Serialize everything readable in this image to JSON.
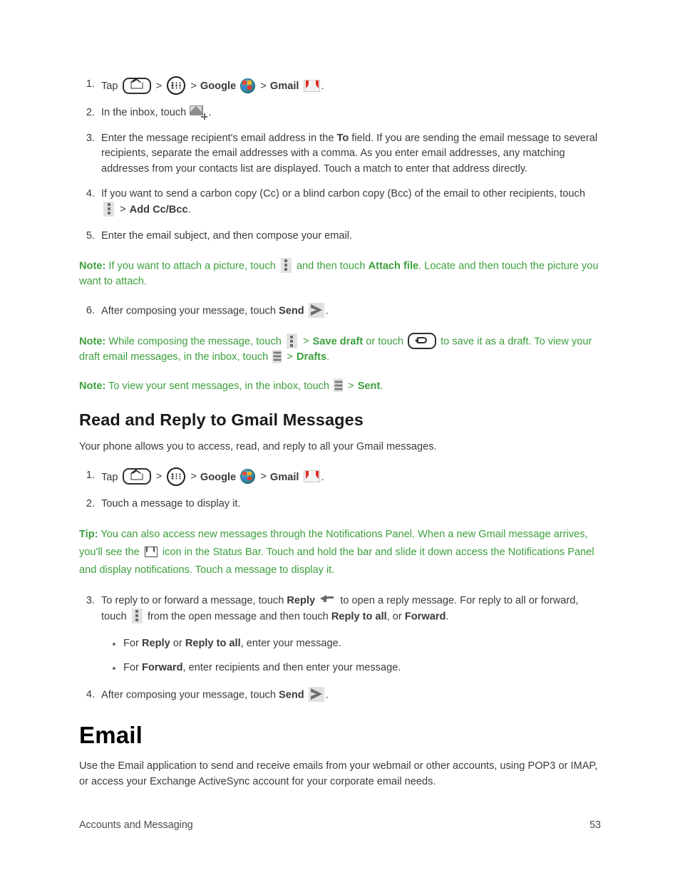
{
  "document": {
    "page_number": "53",
    "footer_section": "Accounts and Messaging",
    "note_color": "#3c9f3c",
    "body_color": "#3b3b3b"
  },
  "compose_steps": {
    "step1": {
      "number": "1.",
      "tap_label": "Tap",
      "sep": ">",
      "google_label": "Google",
      "gmail_label": "Gmail",
      "period": "."
    },
    "step2": {
      "number": "2.",
      "text_before": "In the inbox, touch",
      "period": "."
    },
    "step3": {
      "number": "3.",
      "text_a": "Enter the message recipient's email address in the",
      "bold_to": "To",
      "text_b": "field. If you are sending the email message to several recipients, separate the email addresses with a comma. As you enter email addresses, any matching addresses from your contacts list are displayed. Touch a match to enter that address directly."
    },
    "step4": {
      "number": "4.",
      "text_a": "If you want to send a carbon copy (Cc) or a blind carbon copy (Bcc) of the email to other recipients, touch",
      "sep": ">",
      "bold_add": "Add Cc/Bcc",
      "period": "."
    },
    "step5": {
      "number": "5.",
      "text": "Enter the email subject, and then compose your email."
    },
    "step6": {
      "number": "6.",
      "text_a": "After composing your message, touch",
      "bold_send": "Send",
      "period": "."
    }
  },
  "notes": {
    "attach": {
      "label": "Note:",
      "text_a": "If you want to attach a picture, touch",
      "text_b": "and then touch",
      "bold_attach": "Attach file",
      "text_c": ". Locate and then touch the picture you want to attach."
    },
    "draft": {
      "label": "Note:",
      "text_a": "While composing the message, touch",
      "sep1": ">",
      "bold_save": "Save draft",
      "text_b": "or touch",
      "text_c": "to save it as a draft. To view your draft email messages, in the inbox, touch",
      "sep2": ">",
      "bold_drafts": "Drafts",
      "period": "."
    },
    "sent": {
      "label": "Note:",
      "text_a": "To view your sent messages, in the inbox, touch",
      "sep": ">",
      "bold_sent": "Sent",
      "period": "."
    }
  },
  "read_reply_section": {
    "heading": "Read and Reply to Gmail Messages",
    "intro": "Your phone allows you to access, read, and reply to all your Gmail messages.",
    "step1": {
      "number": "1.",
      "tap_label": "Tap",
      "sep": ">",
      "google_label": "Google",
      "gmail_label": "Gmail",
      "period": "."
    },
    "step2": {
      "number": "2.",
      "text": "Touch a message to display it."
    },
    "tip": {
      "label": "Tip:",
      "text_a": "You can also access new messages through the Notifications Panel. When a new Gmail message arrives, you'll see the",
      "text_b": "icon in the Status Bar. Touch and hold the bar and slide it down access the Notifications Panel and display notifications. Touch a message to display it."
    },
    "step3": {
      "number": "3.",
      "text_a": "To reply to or forward a message, touch",
      "bold_reply": "Reply",
      "text_b": "to open a reply message. For reply to all or forward, touch",
      "text_c": "from the open message and then touch",
      "bold_reply_all": "Reply to all",
      "text_d": ", or",
      "bold_forward": "Forward",
      "period": "."
    },
    "bullets": [
      {
        "text_a": "For",
        "bold_a": "Reply",
        "text_b": "or",
        "bold_b": "Reply to all",
        "text_c": ", enter your message."
      },
      {
        "text_a": "For",
        "bold_a": "Forward",
        "text_b": ", enter recipients and then enter your message."
      }
    ],
    "step4": {
      "number": "4.",
      "text_a": "After composing your message, touch",
      "bold_send": "Send",
      "period": "."
    }
  },
  "email_section": {
    "heading": "Email",
    "body": "Use the Email application to send and receive emails from your webmail or other accounts, using POP3 or IMAP, or access your Exchange ActiveSync account for your corporate email needs."
  },
  "icons": {
    "home": "home-key-icon",
    "apps": "apps-drawer-icon",
    "google": "google-folder-icon",
    "gmail": "gmail-app-icon",
    "compose": "compose-mail-icon",
    "overflow": "overflow-menu-icon",
    "list": "list-menu-icon",
    "back": "back-key-icon",
    "send": "send-icon",
    "reply": "reply-icon",
    "gmail_status": "gmail-status-bar-icon"
  }
}
